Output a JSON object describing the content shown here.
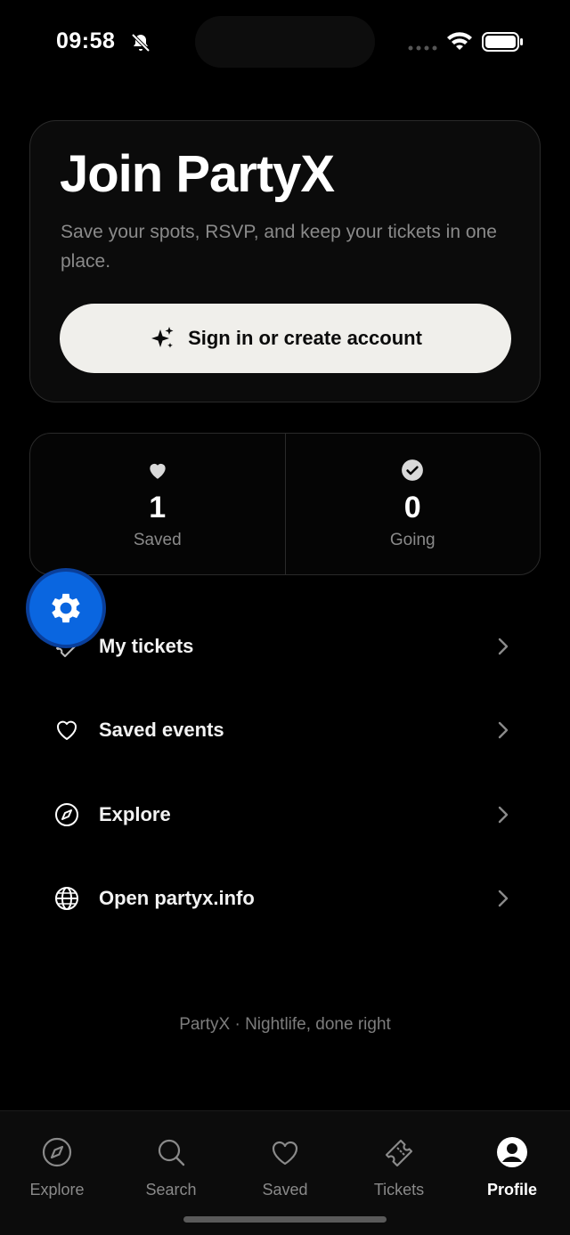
{
  "status_bar": {
    "time": "09:58"
  },
  "join_card": {
    "title": "Join PartyX",
    "subtitle": "Save your spots, RSVP, and keep your tickets in one place.",
    "signin_label": "Sign in or create account"
  },
  "stats": [
    {
      "icon": "heart-icon",
      "value": "1",
      "label": "Saved"
    },
    {
      "icon": "check-circle-icon",
      "value": "0",
      "label": "Going"
    }
  ],
  "menu": [
    {
      "icon": "ticket-icon",
      "label": "My tickets"
    },
    {
      "icon": "heart-outline-icon",
      "label": "Saved events"
    },
    {
      "icon": "compass-icon",
      "label": "Explore"
    },
    {
      "icon": "globe-icon",
      "label": "Open partyx.info"
    }
  ],
  "footer": "PartyX · Nightlife, done right",
  "tabs": [
    {
      "icon": "compass-icon",
      "label": "Explore",
      "active": false
    },
    {
      "icon": "search-icon",
      "label": "Search",
      "active": false
    },
    {
      "icon": "heart-outline-icon",
      "label": "Saved",
      "active": false
    },
    {
      "icon": "ticket-icon",
      "label": "Tickets",
      "active": false
    },
    {
      "icon": "profile-icon",
      "label": "Profile",
      "active": true
    }
  ],
  "colors": {
    "background": "#000000",
    "accent": "#0a66e0",
    "button_bg": "#f0efeb",
    "muted_text": "#8a8a8a"
  }
}
